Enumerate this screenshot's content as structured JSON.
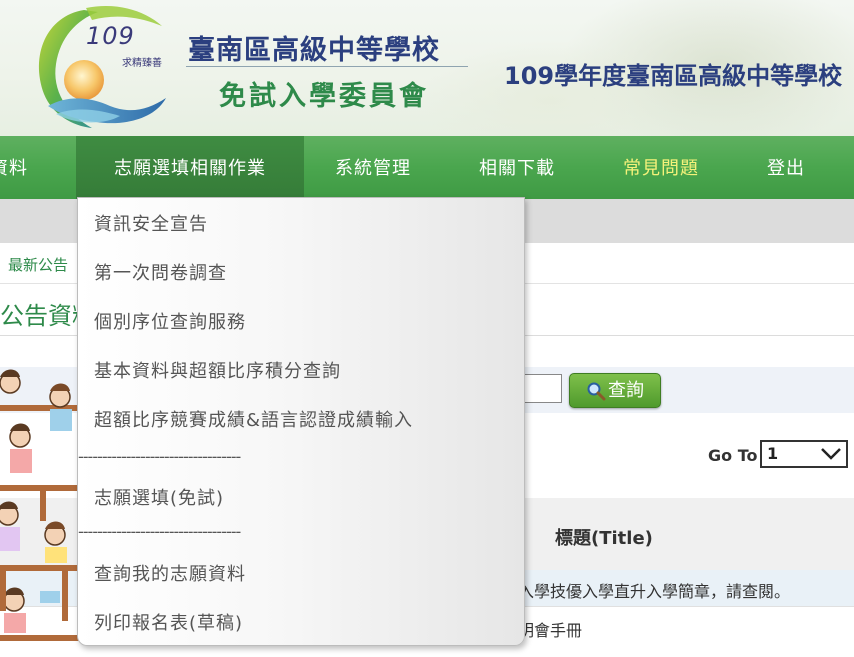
{
  "header": {
    "logo_number": "109",
    "logo_motto": "求精臻善",
    "org_line1": "臺南區高級中等學校",
    "org_line2": "免試入學委員會",
    "year_title": "109學年度臺南區高級中等學校"
  },
  "nav": {
    "items": [
      {
        "label": "資料"
      },
      {
        "label": "志願選填相關作業"
      },
      {
        "label": "系統管理"
      },
      {
        "label": "相關下載"
      },
      {
        "label": "常見問題"
      },
      {
        "label": "登出"
      }
    ],
    "active_index": 1
  },
  "page": {
    "breadcrumb": "最新公告",
    "title": "公告資料",
    "search_button": "查詢",
    "goto_label": "Go To",
    "goto_value": "1",
    "table_header_title": "標題(Title)",
    "rows": [
      {
        "title": "入學技優入學直升入學簡章，請查閱。"
      },
      {
        "title": "明會手冊"
      }
    ]
  },
  "dropdown": {
    "items": [
      {
        "label": "資訊安全宣告"
      },
      {
        "label": "第一次問卷調查"
      },
      {
        "label": "個別序位查詢服務"
      },
      {
        "label": "基本資料與超額比序積分查詢"
      },
      {
        "label": "超額比序競賽成績&語言認證成績輸入"
      },
      {
        "label": "----------------------------------"
      },
      {
        "label": "志願選填(免試)"
      },
      {
        "label": "----------------------------------"
      },
      {
        "label": "查詢我的志願資料"
      },
      {
        "label": "列印報名表(草稿)"
      }
    ]
  },
  "colors": {
    "nav_green": "#4aa64e",
    "nav_active": "#357c38",
    "faq_yellow": "#f6f27a",
    "org_blue": "#2b3f7f",
    "org_green": "#2e8a4a",
    "search_button_green": "#5ea535"
  },
  "icons": {
    "search_button_icon": "magnifier-icon",
    "goto_dropdown_icon": "chevron-down-icon",
    "logo": "school-logo-sun-wave"
  }
}
